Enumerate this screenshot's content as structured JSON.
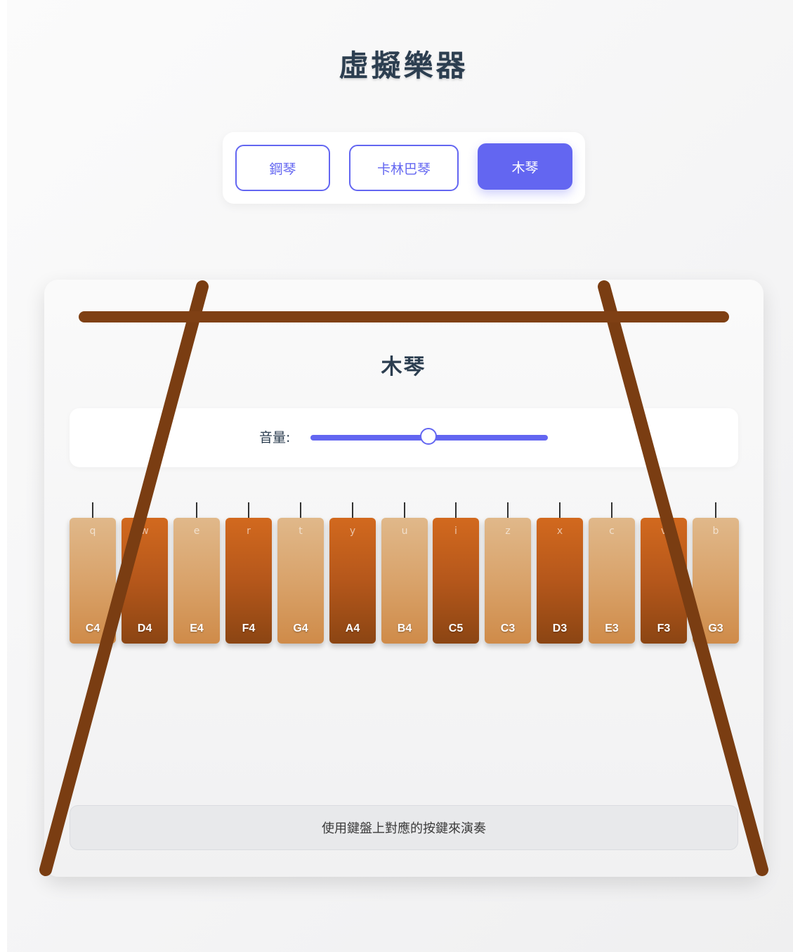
{
  "app": {
    "title": "虛擬樂器"
  },
  "selector": {
    "buttons": [
      {
        "label": "鋼琴",
        "active": false
      },
      {
        "label": "卡林巴琴",
        "active": false
      },
      {
        "label": "木琴",
        "active": true
      }
    ]
  },
  "instrument": {
    "title": "木琴",
    "volume": {
      "label": "音量:",
      "value": 0.5
    },
    "bars": [
      {
        "key": "q",
        "note": "C4",
        "shade": "light"
      },
      {
        "key": "w",
        "note": "D4",
        "shade": "dark"
      },
      {
        "key": "e",
        "note": "E4",
        "shade": "light"
      },
      {
        "key": "r",
        "note": "F4",
        "shade": "dark"
      },
      {
        "key": "t",
        "note": "G4",
        "shade": "light"
      },
      {
        "key": "y",
        "note": "A4",
        "shade": "dark"
      },
      {
        "key": "u",
        "note": "B4",
        "shade": "light"
      },
      {
        "key": "i",
        "note": "C5",
        "shade": "dark"
      },
      {
        "key": "z",
        "note": "C3",
        "shade": "light"
      },
      {
        "key": "x",
        "note": "D3",
        "shade": "dark"
      },
      {
        "key": "c",
        "note": "E3",
        "shade": "light"
      },
      {
        "key": "v",
        "note": "F3",
        "shade": "dark"
      },
      {
        "key": "b",
        "note": "G3",
        "shade": "light"
      }
    ],
    "hint": "使用鍵盤上對應的按鍵來演奏"
  },
  "colors": {
    "accent": "#6366f1",
    "text": "#2c3e50",
    "wood_light": "#d9a36b",
    "wood_dark": "#b5571b",
    "frame": "#8b4513"
  }
}
